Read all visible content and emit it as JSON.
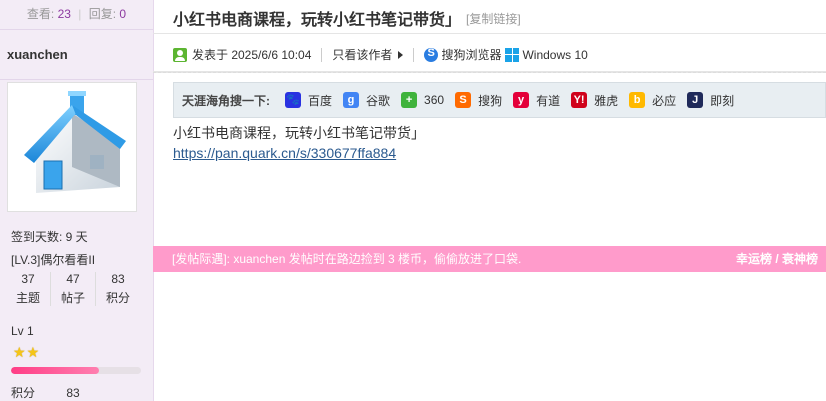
{
  "sidebar": {
    "views_label": "查看:",
    "views": "23",
    "replies_label": "回复:",
    "replies": "0",
    "author": "xuanchen",
    "sign_days": "签到天数: 9 天",
    "level_title": "[LV.3]偶尔看看II",
    "counts": [
      {
        "num": "37",
        "label": "主题"
      },
      {
        "num": "47",
        "label": "帖子"
      },
      {
        "num": "83",
        "label": "积分"
      }
    ],
    "lv": "Lv 1",
    "progress": 0.68,
    "score_label": "积分",
    "score": "83"
  },
  "post": {
    "title": "小红书电商课程，玩转小红书笔记带货」",
    "copy_link": "[复制链接]",
    "posted_at": "发表于 2025/6/6 10:04",
    "only_author": "只看该作者",
    "browser": "搜狗浏览器",
    "os": "Windows 10"
  },
  "search_bar": {
    "label": "天涯海角搜一下:",
    "engines": [
      {
        "name": "百度",
        "icon": "baidu-icon",
        "glyph": "🐾",
        "color": "#2932e1"
      },
      {
        "name": "谷歌",
        "icon": "google-icon",
        "glyph": "g",
        "color": "#4285f4"
      },
      {
        "name": "360",
        "icon": "360-icon",
        "glyph": "+",
        "color": "#3fb33c"
      },
      {
        "name": "搜狗",
        "icon": "sogou-icon",
        "glyph": "S",
        "color": "#ff6a00"
      },
      {
        "name": "有道",
        "icon": "youdao-icon",
        "glyph": "y",
        "color": "#e4003a"
      },
      {
        "name": "雅虎",
        "icon": "yahoo-icon",
        "glyph": "Y!",
        "color": "#d0021b"
      },
      {
        "name": "必应",
        "icon": "bing-icon",
        "glyph": "b",
        "color": "#ffb900"
      },
      {
        "name": "即刻",
        "icon": "jike-icon",
        "glyph": "J",
        "color": "#1f2a5a"
      }
    ]
  },
  "content": {
    "line1": "小红书电商课程，玩转小红书笔记带货」",
    "link": "https://pan.quark.cn/s/330677ffa884"
  },
  "banner": {
    "text": "[发帖际遇]: xuanchen 发帖时在路边捡到 3 楼币，偷偷放进了口袋.",
    "right": "幸运榜 / 衰神榜"
  }
}
